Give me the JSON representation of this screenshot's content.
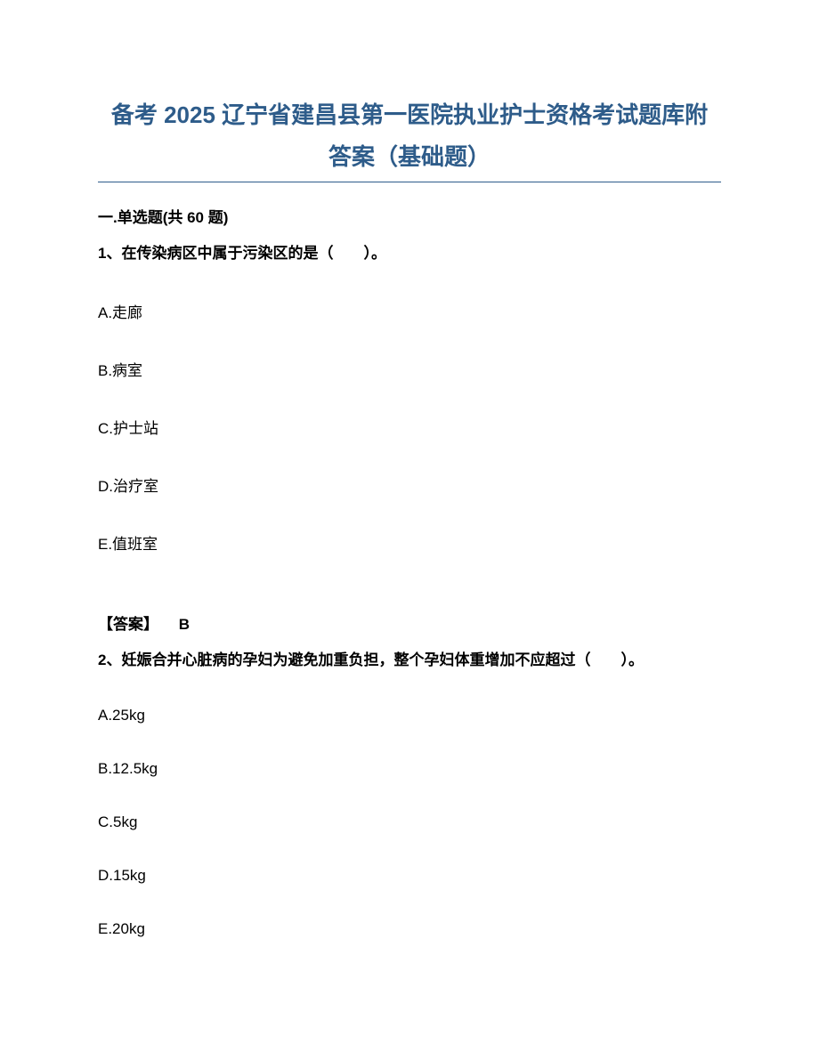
{
  "title_line1": "备考 2025 辽宁省建昌县第一医院执业护士资格考试题库附",
  "title_line2": "答案（基础题）",
  "section_header": "一.单选题(共 60 题)",
  "q1": {
    "text": "1、在传染病区中属于污染区的是（　　）。",
    "options": {
      "a": "A.走廊",
      "b": "B.病室",
      "c": "C.护士站",
      "d": "D.治疗室",
      "e": "E.值班室"
    },
    "answer_label": "【答案】",
    "answer_value": "B"
  },
  "q2": {
    "text": "2、妊娠合并心脏病的孕妇为避免加重负担，整个孕妇体重增加不应超过（　　）。",
    "options": {
      "a": "A.25kg",
      "b": "B.12.5kg",
      "c": "C.5kg",
      "d": "D.15kg",
      "e": "E.20kg"
    }
  }
}
